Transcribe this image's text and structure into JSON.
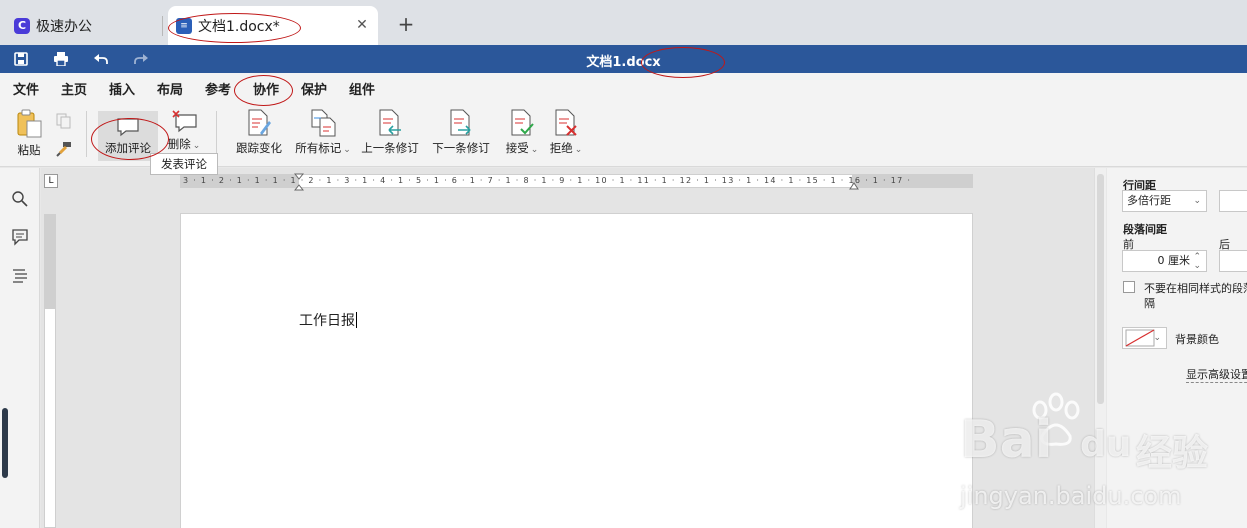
{
  "tabs": {
    "app_title": "极速办公",
    "doc_title": "文档1.docx*",
    "close_glyph": "✕",
    "new_tab_glyph": "+"
  },
  "titlebar": {
    "title": "文档1.docx",
    "icons": [
      "save-icon",
      "print-icon",
      "undo-icon",
      "redo-icon"
    ]
  },
  "menu": {
    "items": [
      "文件",
      "主页",
      "插入",
      "布局",
      "参考",
      "协作",
      "保护",
      "组件"
    ],
    "active": "协作"
  },
  "ribbon": {
    "paste": "粘贴",
    "add_comment": "添加评论",
    "delete": "删除",
    "track_changes": "跟踪变化",
    "all_markup": "所有标记",
    "prev_change": "上一条修订",
    "next_change": "下一条修订",
    "accept": "接受",
    "reject": "拒绝"
  },
  "tooltip": {
    "text": "发表评论"
  },
  "document": {
    "body_text": "工作日报",
    "hruler_ticks": "3 · 1 · 2 · 1 · 1 · 1 · 1 · 2 · 1 · 3 · 1 · 4 · 1 · 5 · 1 · 6 · 1 · 7 · 1 · 8 · 1 · 9 · 1 · 10 · 1 · 11 · 1 · 12 · 1 · 13 · 1 · 14 · 1 · 15 · 1 · 16 · 1 · 17 ·",
    "ruler_corner": "L"
  },
  "right_panel": {
    "line_spacing_label": "行间距",
    "line_spacing_value": "多倍行距",
    "para_spacing_label": "段落间距",
    "before_label": "前",
    "after_label": "后",
    "before_value": "0 厘米",
    "no_space_same_style": "不要在相同样式的段落间",
    "no_space_wrap": "隔",
    "bg_color_label": "背景颜色",
    "advanced_link": "显示高级设置"
  },
  "watermark": {
    "brand": "Bai",
    "brand_tail": "du",
    "jingyan": "经验",
    "url": "jingyan.baidu.com"
  },
  "colors": {
    "title_bar": "#2b579a",
    "annotation_red": "#c01818",
    "app_logo": "#4a3bd8"
  }
}
